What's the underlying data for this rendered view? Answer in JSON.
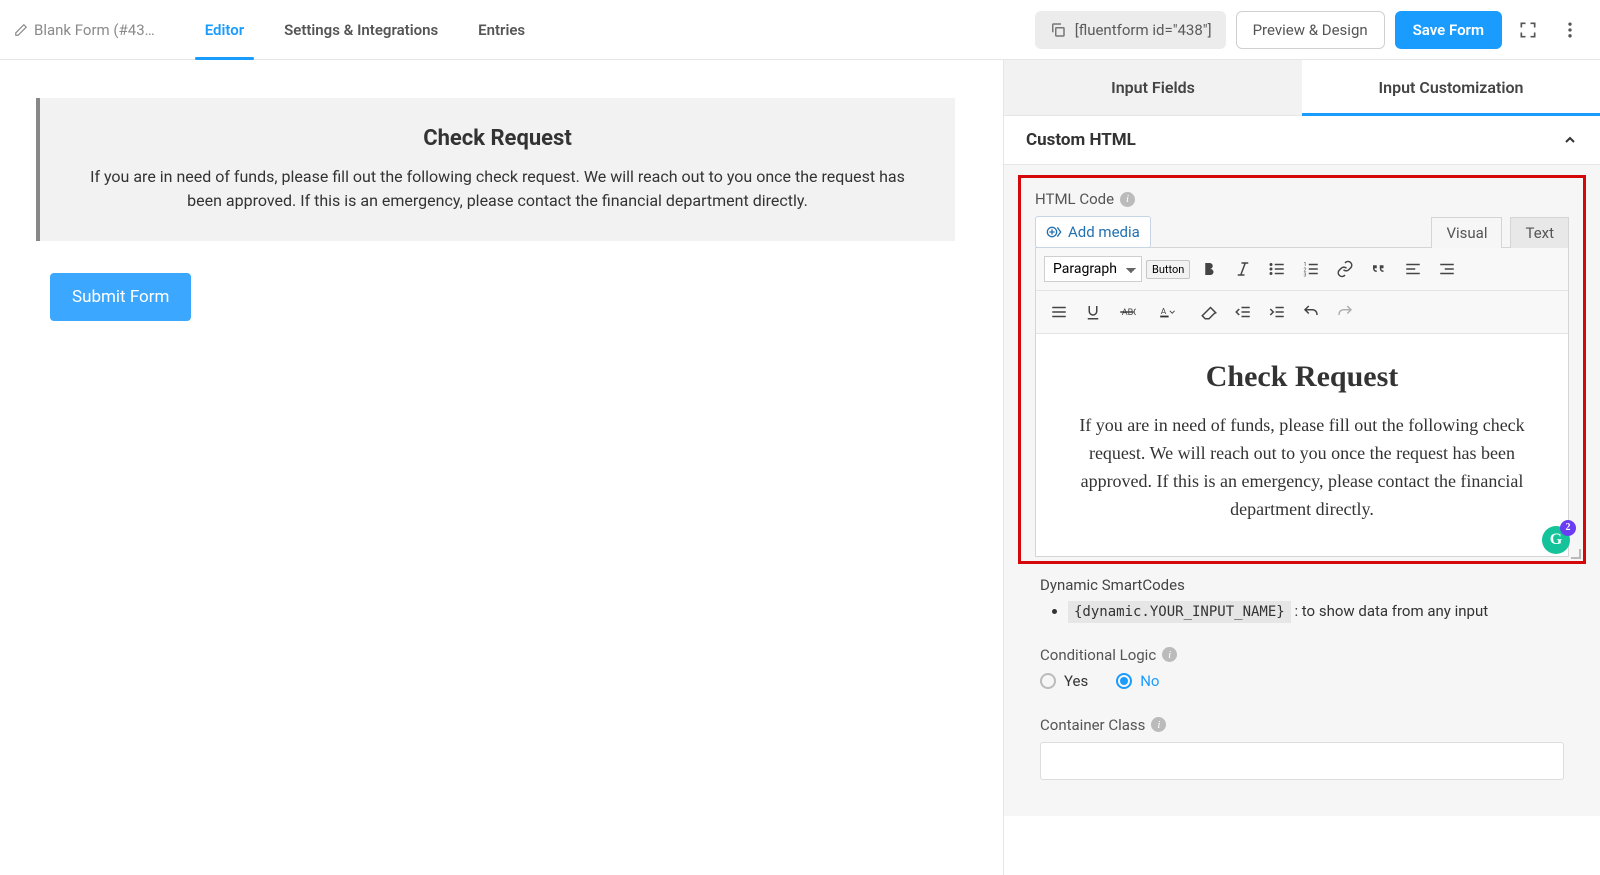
{
  "header": {
    "form_name": "Blank Form (#43…",
    "tabs": [
      "Editor",
      "Settings & Integrations",
      "Entries"
    ],
    "active_tab": 0,
    "shortcode": "[fluentform id=\"438\"]",
    "preview_label": "Preview & Design",
    "save_label": "Save Form"
  },
  "form_preview": {
    "title": "Check Request",
    "body": "If you are in need of funds, please fill out the following check request. We will reach out to you once the request has been approved. If this is an emergency, please contact the financial department directly.",
    "submit_label": "Submit Form"
  },
  "sidebar": {
    "tabs": [
      "Input Fields",
      "Input Customization"
    ],
    "active_tab": 1,
    "section_title": "Custom HTML",
    "html_code_label": "HTML Code",
    "add_media_label": "Add media",
    "wysiwyg_tabs": [
      "Visual",
      "Text"
    ],
    "paragraph_label": "Paragraph",
    "button_token": "Button",
    "editor_heading": "Check Request",
    "editor_body": "If you are in need of funds, please fill out the following check request. We will reach out to you once the request has been approved. If this is an emergency, please contact the financial department directly.",
    "grammarly_count": "2",
    "smartcodes_label": "Dynamic SmartCodes",
    "smartcode_token": "{dynamic.YOUR_INPUT_NAME}",
    "smartcode_desc": " : to show data from any input",
    "conditional_label": "Conditional Logic",
    "radio_yes": "Yes",
    "radio_no": "No",
    "container_class_label": "Container Class"
  }
}
